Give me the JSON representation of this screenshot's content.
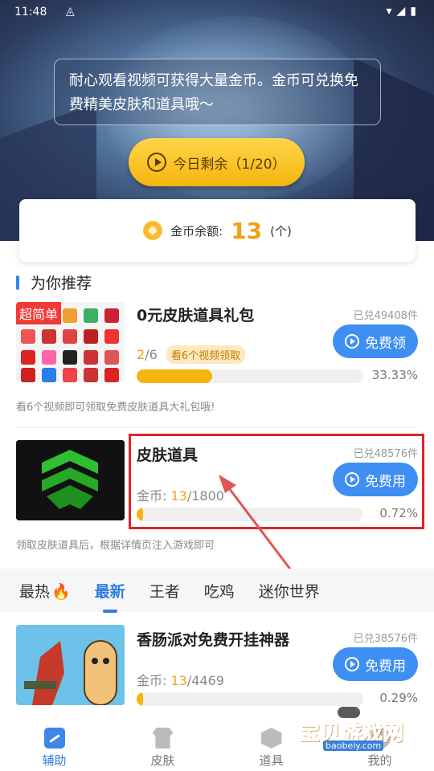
{
  "status_bar": {
    "time": "11:48"
  },
  "hero": {
    "notice": "耐心观看视频可获得大量金币。金币可兑换免费精美皮肤和道具哦～",
    "today_button": "今日剩余（1/20）"
  },
  "balance": {
    "label": "金币余额:",
    "value": "13",
    "unit": "(个)"
  },
  "section": {
    "title": "为你推荐"
  },
  "items": [
    {
      "tag": "超简单",
      "title": "0元皮肤道具礼包",
      "redeemed": "已兑49408件",
      "button": "免费领",
      "progress_text_current": "2",
      "progress_text_total": "/6",
      "watch_hint": "看6个视频领取",
      "progress": 0.3333,
      "percent": "33.33%",
      "desc": "看6个视频即可领取免费皮肤道具大礼包哦!"
    },
    {
      "title": "皮肤道具",
      "redeemed": "已兑48576件",
      "button": "免费用",
      "coins_label": "金币: ",
      "coins_current": "13",
      "coins_total": "/1800",
      "progress": 0.0072,
      "percent": "0.72%",
      "desc": "领取皮肤道具后，根据详情页注入游戏即可"
    },
    {
      "title": "香肠派对免费开挂神器",
      "redeemed": "已兑38576件",
      "button": "免费用",
      "coins_label": "金币: ",
      "coins_current": "13",
      "coins_total": "/4469",
      "progress": 0.0029,
      "percent": "0.29%"
    }
  ],
  "tabs": [
    {
      "label": "最热"
    },
    {
      "label": "最新"
    },
    {
      "label": "王者"
    },
    {
      "label": "吃鸡"
    },
    {
      "label": "迷你世界"
    }
  ],
  "bottom_nav": [
    {
      "label": "辅助",
      "icon": "assist-icon"
    },
    {
      "label": "皮肤",
      "icon": "tshirt-icon"
    },
    {
      "label": "道具",
      "icon": "cube-icon"
    },
    {
      "label": "我的",
      "icon": "user-icon"
    }
  ],
  "watermark": {
    "title": "宝贝游戏网",
    "url": "baobeiy.com"
  },
  "colors": {
    "accent": "#3f8ff2",
    "gold": "#f0a010",
    "highlight": "#e02424"
  }
}
